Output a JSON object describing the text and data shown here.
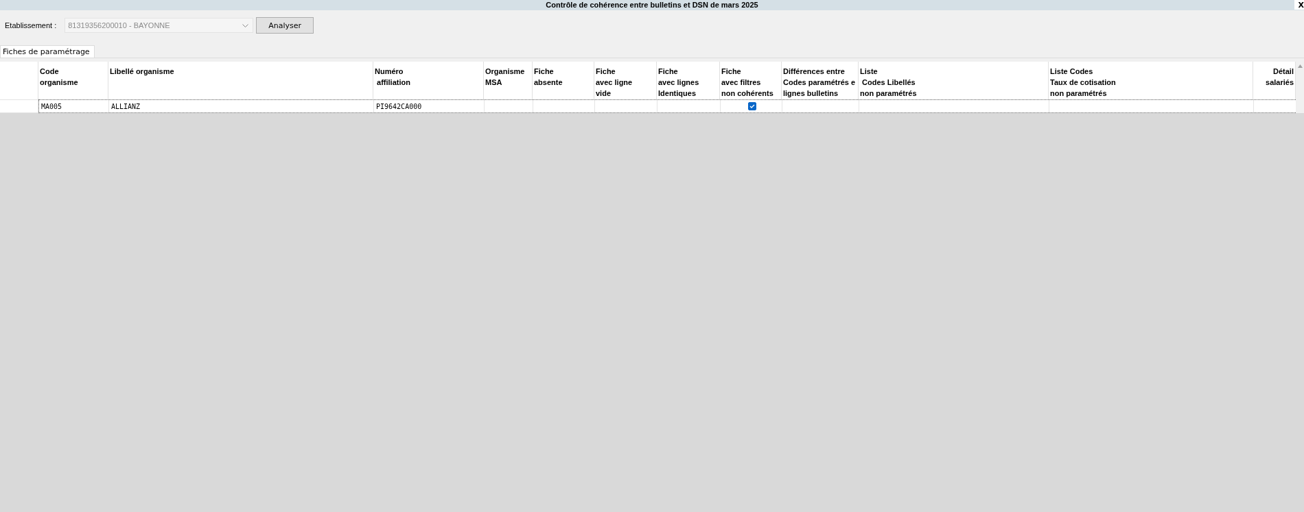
{
  "window": {
    "title": "Contrôle de cohérence entre bulletins et DSN de mars 2025",
    "close": "X"
  },
  "toolbar": {
    "label": "Etablissement :",
    "select": {
      "value": "81319356200010 - BAYONNE",
      "disabled": true
    },
    "button": "Analyser"
  },
  "tabs": [
    {
      "label": "Fiches de paramétrage",
      "selected": true
    }
  ],
  "table": {
    "columns": [
      {
        "label": "Code\norganisme"
      },
      {
        "label": "Libellé organisme"
      },
      {
        "label": "Numéro\n affiliation"
      },
      {
        "label": "Organisme\nMSA"
      },
      {
        "label": "Fiche\nabsente"
      },
      {
        "label": "Fiche\navec ligne\nvide"
      },
      {
        "label": "Fiche\navec lignes\nIdentiques"
      },
      {
        "label": "Fiche\navec filtres\nnon cohérents"
      },
      {
        "label": "Différences entre\nCodes paramétrés e\nlignes bulletins"
      },
      {
        "label": "Liste\n Codes Libellés\nnon paramétrés"
      },
      {
        "label": "Liste Codes\nTaux de cotisation\nnon paramétrés"
      },
      {
        "label": "Détail\nsalariés"
      }
    ],
    "rows": [
      {
        "selected": true,
        "cells": [
          {
            "kind": "text",
            "text": "MA005"
          },
          {
            "kind": "text",
            "text": "ALLIANZ"
          },
          {
            "kind": "text",
            "text": "PI9642CA000"
          },
          {
            "kind": "blank"
          },
          {
            "kind": "blank"
          },
          {
            "kind": "blank"
          },
          {
            "kind": "blank"
          },
          {
            "kind": "checkbox",
            "checked": true
          },
          {
            "kind": "blank"
          },
          {
            "kind": "blank"
          },
          {
            "kind": "blank"
          },
          {
            "kind": "blank"
          }
        ]
      }
    ]
  }
}
